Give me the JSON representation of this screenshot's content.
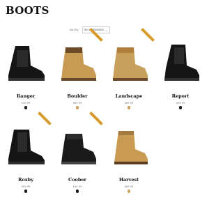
{
  "page": {
    "title": "BOOTS"
  },
  "sort": {
    "label": "Sort By",
    "selected": "RECOMMENDED",
    "chevron_icon": "chevron-down-icon"
  },
  "colors": {
    "ribbon": "#d49a2a",
    "black": "#1a1a1a",
    "tan": "#c9a15a"
  },
  "products": [
    {
      "name": "Ranger",
      "price": "$49.99",
      "swatch": "#1a1a1a",
      "style": "chelsea-black",
      "ribbon": false
    },
    {
      "name": "Boulder",
      "price": "$89.99",
      "swatch": "#c9a15a",
      "style": "work-tan",
      "ribbon": true
    },
    {
      "name": "Landscape",
      "price": "$89.99",
      "swatch": "#c9a15a",
      "style": "lace-tan",
      "ribbon": true
    },
    {
      "name": "Report",
      "price": "$49.99",
      "swatch": "#1a1a1a",
      "style": "combat-black",
      "ribbon": false
    },
    {
      "name": "Roxby",
      "price": "$59.99",
      "swatch": "#1a1a1a",
      "style": "chelsea-black2",
      "ribbon": true
    },
    {
      "name": "Coober",
      "price": "$49.99",
      "swatch": "#1a1a1a",
      "style": "hiker-black",
      "ribbon": true
    },
    {
      "name": "Harvest",
      "price": "$89.99",
      "swatch": "#c9a15a",
      "style": "work-tan2",
      "ribbon": false
    }
  ]
}
